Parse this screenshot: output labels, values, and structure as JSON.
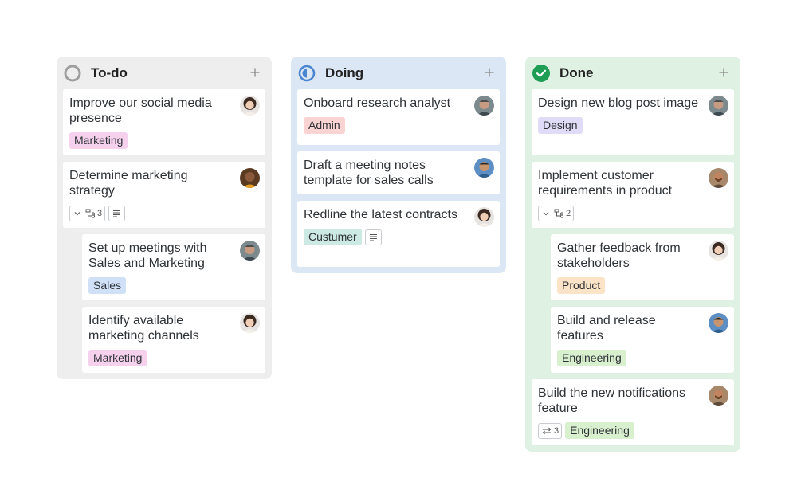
{
  "columns": [
    {
      "title": "To-do",
      "cards": [
        {
          "title": "Improve our social media presence",
          "tags": [
            "Marketing"
          ]
        },
        {
          "title": "Determine marketing strategy",
          "subtasks_count": "3"
        },
        {
          "title": "Set up meetings with Sales and Marketing",
          "tags": [
            "Sales"
          ]
        },
        {
          "title": "Identify available marketing channels",
          "tags": [
            "Marketing"
          ]
        }
      ]
    },
    {
      "title": "Doing",
      "cards": [
        {
          "title": "Onboard research analyst",
          "tags": [
            "Admin"
          ]
        },
        {
          "title": "Draft a meeting notes template for sales calls"
        },
        {
          "title": "Redline the latest contracts",
          "tags": [
            "Custumer"
          ]
        }
      ]
    },
    {
      "title": "Done",
      "cards": [
        {
          "title": "Design new blog post image",
          "tags": [
            "Design"
          ]
        },
        {
          "title": "Implement customer requirements in product",
          "subtasks_count": "2"
        },
        {
          "title": "Gather feedback from stakeholders",
          "tags": [
            "Product"
          ]
        },
        {
          "title": "Build and release features",
          "tags": [
            "Engineering"
          ]
        },
        {
          "title": "Build the new notifications feature",
          "repeat_count": "3",
          "tags": [
            "Engineering"
          ]
        }
      ]
    }
  ],
  "tag_colors": {
    "Marketing": "#f6d1ee",
    "Sales": "#cfe0f7",
    "Admin": "#fad3d3",
    "Custumer": "#cde9e3",
    "Design": "#e0dcf7",
    "Product": "#fbe3c7",
    "Engineering": "#d9f0cf"
  },
  "status_colors": {
    "todo": "#9e9e9e",
    "doing": "#4a86d0",
    "done": "#1e9e54"
  }
}
